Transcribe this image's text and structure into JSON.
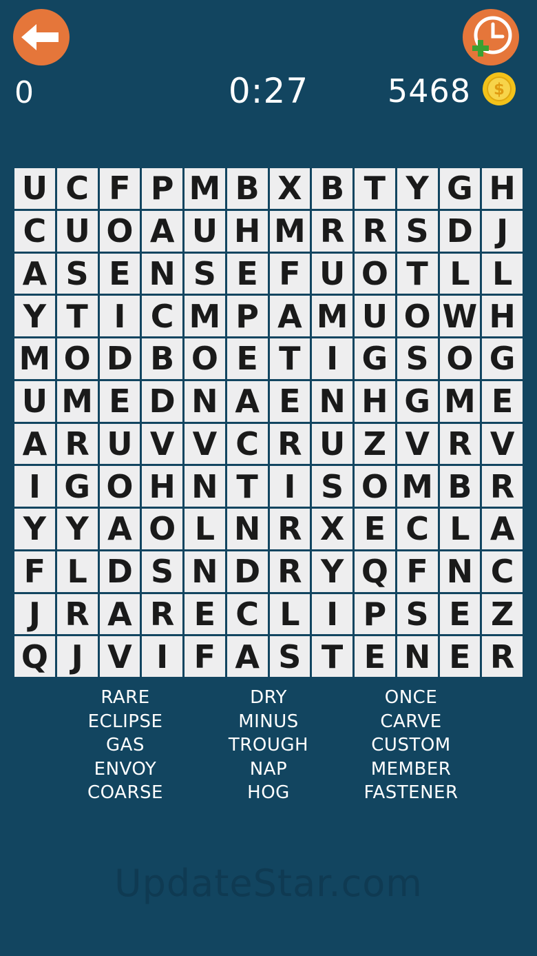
{
  "header": {
    "score": "0",
    "timer": "0:27",
    "coins": "5468",
    "back_icon": "arrow-left-icon",
    "add_time_icon": "clock-plus-icon",
    "coin_icon": "dollar-coin-icon"
  },
  "grid": {
    "rows": [
      "UCFPMBXBTYGH",
      "CUOAUHMRRSDJ",
      "ASENSEFUOTLL",
      "YTICMPAMUOWH",
      "MODBOETIGSOG",
      "UMEDNAENHGME",
      "ARUVVCRUZVRV",
      "IGOHNTISOMBR",
      "YYAOLNRXECLA",
      "FLDSNDRYQFNC",
      "JRARECLIPSEZ",
      "QJVIFASTENER"
    ]
  },
  "words": {
    "columns": [
      [
        "RARE",
        "ECLIPSE",
        "GAS",
        "ENVOY",
        "COARSE"
      ],
      [
        "DRY",
        "MINUS",
        "TROUGH",
        "NAP",
        "HOG"
      ],
      [
        "ONCE",
        "CARVE",
        "CUSTOM",
        "MEMBER",
        "FASTENER"
      ]
    ]
  },
  "watermark": "UpdateStar.com",
  "colors": {
    "background": "#124560",
    "accent": "#e5763a",
    "cell": "#eeeeef",
    "coin": "#f3c21a",
    "plus": "#3aa132"
  }
}
